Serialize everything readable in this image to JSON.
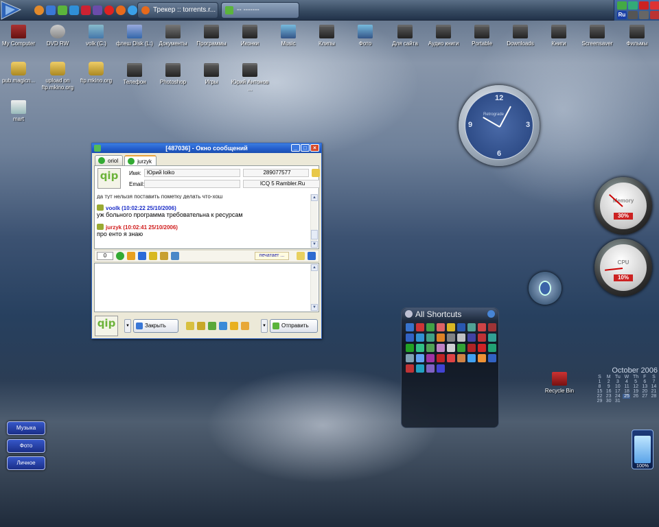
{
  "taskbar": {
    "tasks": [
      {
        "label": "Трекер :: torrents.r..."
      },
      {
        "label": "-- -------"
      }
    ],
    "tray": [
      "Ru"
    ]
  },
  "desktop": {
    "icons": [
      {
        "label": "My Computer",
        "icon": "computer-icon"
      },
      {
        "label": "DVD RW",
        "icon": "dvd-icon"
      },
      {
        "label": "volk (C:)",
        "icon": "drive-icon"
      },
      {
        "label": "флеш Disk (L:)",
        "icon": "flash-drive-icon"
      },
      {
        "label": "Документы",
        "icon": "documents-icon"
      },
      {
        "label": "Программы",
        "icon": "folder-icon"
      },
      {
        "label": "Иконки",
        "icon": "folder-icon"
      },
      {
        "label": "Music",
        "icon": "music-folder-icon"
      },
      {
        "label": "Клипы",
        "icon": "folder-icon"
      },
      {
        "label": "Фото",
        "icon": "photo-folder-icon"
      },
      {
        "label": "Для сайта",
        "icon": "folder-icon"
      },
      {
        "label": "Аудио книги",
        "icon": "folder-icon"
      },
      {
        "label": "Portable",
        "icon": "folder-icon"
      },
      {
        "label": "Downloads",
        "icon": "folder-icon"
      },
      {
        "label": "Книги",
        "icon": "folder-icon"
      },
      {
        "label": "Screensaver",
        "icon": "folder-icon"
      },
      {
        "label": "Фильмы",
        "icon": "folder-icon"
      },
      {
        "label": "pub.magicn...",
        "icon": "network-folder-icon"
      },
      {
        "label": "upload on ftp.mkino.org",
        "icon": "network-folder-icon"
      },
      {
        "label": "ftp.mkino.org",
        "icon": "network-folder-icon"
      },
      {
        "label": "Телефон",
        "icon": "folder-icon"
      },
      {
        "label": "Photoshop",
        "icon": "folder-icon"
      },
      {
        "label": "Игры",
        "icon": "folder-icon"
      },
      {
        "label": "Юрий Антонов ...",
        "icon": "folder-icon"
      },
      {
        "label": "mart",
        "icon": "spreadsheet-icon"
      },
      {
        "label": "Recycle Bin",
        "icon": "recycle-bin-icon"
      }
    ]
  },
  "clock": {
    "brand": "Retrograde",
    "numbers": [
      "12",
      "3",
      "6",
      "9"
    ]
  },
  "gauges": {
    "memory": {
      "label": "Memory",
      "value": "30%",
      "level": 0.3
    },
    "cpu": {
      "label": "CPU",
      "value": "10%",
      "level": 0.1
    }
  },
  "shortcuts": {
    "title": "All Shortcuts"
  },
  "calendar": {
    "title": "October 2006",
    "weekdays": [
      "S",
      "M",
      "Tu",
      "W",
      "Th",
      "F",
      "S"
    ],
    "weeks": [
      [
        "1",
        "2",
        "3",
        "4",
        "5",
        "6",
        "7"
      ],
      [
        "8",
        "9",
        "10",
        "11",
        "12",
        "13",
        "14"
      ],
      [
        "15",
        "16",
        "17",
        "18",
        "19",
        "20",
        "21"
      ],
      [
        "22",
        "23",
        "24",
        "25",
        "26",
        "27",
        "28"
      ],
      [
        "29",
        "30",
        "31",
        "",
        "",
        "",
        ""
      ]
    ],
    "today": "25"
  },
  "battery": {
    "value": "100%",
    "level": 1.0
  },
  "launcher": {
    "items": [
      "Музыка",
      "Фото",
      "Личное"
    ]
  },
  "qip": {
    "title": "[487036] - Окно сообщений",
    "tabs": [
      "oriol",
      "jurzyk"
    ],
    "logo": "qip",
    "name_label": "Имя:",
    "name_value": "Юрий loiko",
    "uin_value": "289077577",
    "email_label": "Email:",
    "client_value": "ICQ 5 Rambler.Ru",
    "history_cut": "да тут нелызя поставить пометку делать что-хош",
    "messages": [
      {
        "header": "voolk (10:02:22 25/10/2006)",
        "text": "уж больного программа требовательна к ресурсам",
        "color": "#1a2cc8"
      },
      {
        "header": "jurzyk (10:02:41 25/10/2006)",
        "text": "про енто я знаю",
        "color": "#d01a1a"
      }
    ],
    "counter": "0",
    "typing": "печатает ...",
    "close_label": "Закрыть",
    "send_label": "Отправить"
  }
}
